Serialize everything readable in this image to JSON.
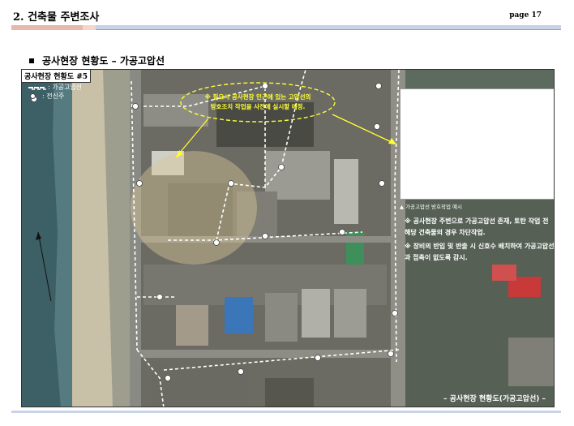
{
  "header": {
    "title": "2. 건축물 주변조사",
    "page": "page 17"
  },
  "section": {
    "heading": "공사현장 현황도 – 가공고압선"
  },
  "map": {
    "label": "공사현장 현황도 #5",
    "legend": {
      "line_label": ": 가공고압선",
      "dot_label": ": 전신주"
    },
    "callout": {
      "line1": "※ 필요시 공사현장 인근에 있는 고압선의",
      "line2": "방호조치 작업을 사전에 실시할 예정."
    },
    "inset_caption": "▲ 가공고압선 방호작업 예시",
    "notes": [
      "※ 공사현장 주변으로 가공고압선 존재, 토탄 작업 전 해당 건축물의 경우 차단작업.",
      "※ 장비의 반입 및 반출 시 신호수 배치하여 가공고압선과 접촉이 없도록 감시."
    ],
    "bottom_caption": "– 공사현장 현황도(가공고압선) –"
  },
  "colors": {
    "callout_text": "#ffff33",
    "header_accent": "#e8b8a8",
    "header_bar": "#c8d3e8"
  }
}
